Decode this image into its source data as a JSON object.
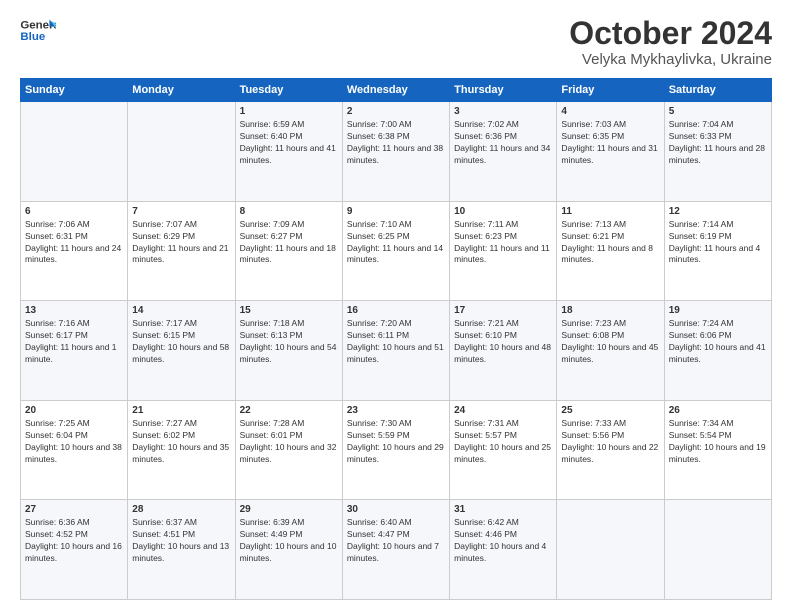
{
  "header": {
    "logo_line1": "General",
    "logo_line2": "Blue",
    "month": "October 2024",
    "location": "Velyka Mykhaylivka, Ukraine"
  },
  "weekdays": [
    "Sunday",
    "Monday",
    "Tuesday",
    "Wednesday",
    "Thursday",
    "Friday",
    "Saturday"
  ],
  "weeks": [
    [
      {
        "day": "",
        "info": ""
      },
      {
        "day": "",
        "info": ""
      },
      {
        "day": "1",
        "info": "Sunrise: 6:59 AM\nSunset: 6:40 PM\nDaylight: 11 hours and 41 minutes."
      },
      {
        "day": "2",
        "info": "Sunrise: 7:00 AM\nSunset: 6:38 PM\nDaylight: 11 hours and 38 minutes."
      },
      {
        "day": "3",
        "info": "Sunrise: 7:02 AM\nSunset: 6:36 PM\nDaylight: 11 hours and 34 minutes."
      },
      {
        "day": "4",
        "info": "Sunrise: 7:03 AM\nSunset: 6:35 PM\nDaylight: 11 hours and 31 minutes."
      },
      {
        "day": "5",
        "info": "Sunrise: 7:04 AM\nSunset: 6:33 PM\nDaylight: 11 hours and 28 minutes."
      }
    ],
    [
      {
        "day": "6",
        "info": "Sunrise: 7:06 AM\nSunset: 6:31 PM\nDaylight: 11 hours and 24 minutes."
      },
      {
        "day": "7",
        "info": "Sunrise: 7:07 AM\nSunset: 6:29 PM\nDaylight: 11 hours and 21 minutes."
      },
      {
        "day": "8",
        "info": "Sunrise: 7:09 AM\nSunset: 6:27 PM\nDaylight: 11 hours and 18 minutes."
      },
      {
        "day": "9",
        "info": "Sunrise: 7:10 AM\nSunset: 6:25 PM\nDaylight: 11 hours and 14 minutes."
      },
      {
        "day": "10",
        "info": "Sunrise: 7:11 AM\nSunset: 6:23 PM\nDaylight: 11 hours and 11 minutes."
      },
      {
        "day": "11",
        "info": "Sunrise: 7:13 AM\nSunset: 6:21 PM\nDaylight: 11 hours and 8 minutes."
      },
      {
        "day": "12",
        "info": "Sunrise: 7:14 AM\nSunset: 6:19 PM\nDaylight: 11 hours and 4 minutes."
      }
    ],
    [
      {
        "day": "13",
        "info": "Sunrise: 7:16 AM\nSunset: 6:17 PM\nDaylight: 11 hours and 1 minute."
      },
      {
        "day": "14",
        "info": "Sunrise: 7:17 AM\nSunset: 6:15 PM\nDaylight: 10 hours and 58 minutes."
      },
      {
        "day": "15",
        "info": "Sunrise: 7:18 AM\nSunset: 6:13 PM\nDaylight: 10 hours and 54 minutes."
      },
      {
        "day": "16",
        "info": "Sunrise: 7:20 AM\nSunset: 6:11 PM\nDaylight: 10 hours and 51 minutes."
      },
      {
        "day": "17",
        "info": "Sunrise: 7:21 AM\nSunset: 6:10 PM\nDaylight: 10 hours and 48 minutes."
      },
      {
        "day": "18",
        "info": "Sunrise: 7:23 AM\nSunset: 6:08 PM\nDaylight: 10 hours and 45 minutes."
      },
      {
        "day": "19",
        "info": "Sunrise: 7:24 AM\nSunset: 6:06 PM\nDaylight: 10 hours and 41 minutes."
      }
    ],
    [
      {
        "day": "20",
        "info": "Sunrise: 7:25 AM\nSunset: 6:04 PM\nDaylight: 10 hours and 38 minutes."
      },
      {
        "day": "21",
        "info": "Sunrise: 7:27 AM\nSunset: 6:02 PM\nDaylight: 10 hours and 35 minutes."
      },
      {
        "day": "22",
        "info": "Sunrise: 7:28 AM\nSunset: 6:01 PM\nDaylight: 10 hours and 32 minutes."
      },
      {
        "day": "23",
        "info": "Sunrise: 7:30 AM\nSunset: 5:59 PM\nDaylight: 10 hours and 29 minutes."
      },
      {
        "day": "24",
        "info": "Sunrise: 7:31 AM\nSunset: 5:57 PM\nDaylight: 10 hours and 25 minutes."
      },
      {
        "day": "25",
        "info": "Sunrise: 7:33 AM\nSunset: 5:56 PM\nDaylight: 10 hours and 22 minutes."
      },
      {
        "day": "26",
        "info": "Sunrise: 7:34 AM\nSunset: 5:54 PM\nDaylight: 10 hours and 19 minutes."
      }
    ],
    [
      {
        "day": "27",
        "info": "Sunrise: 6:36 AM\nSunset: 4:52 PM\nDaylight: 10 hours and 16 minutes."
      },
      {
        "day": "28",
        "info": "Sunrise: 6:37 AM\nSunset: 4:51 PM\nDaylight: 10 hours and 13 minutes."
      },
      {
        "day": "29",
        "info": "Sunrise: 6:39 AM\nSunset: 4:49 PM\nDaylight: 10 hours and 10 minutes."
      },
      {
        "day": "30",
        "info": "Sunrise: 6:40 AM\nSunset: 4:47 PM\nDaylight: 10 hours and 7 minutes."
      },
      {
        "day": "31",
        "info": "Sunrise: 6:42 AM\nSunset: 4:46 PM\nDaylight: 10 hours and 4 minutes."
      },
      {
        "day": "",
        "info": ""
      },
      {
        "day": "",
        "info": ""
      }
    ]
  ]
}
